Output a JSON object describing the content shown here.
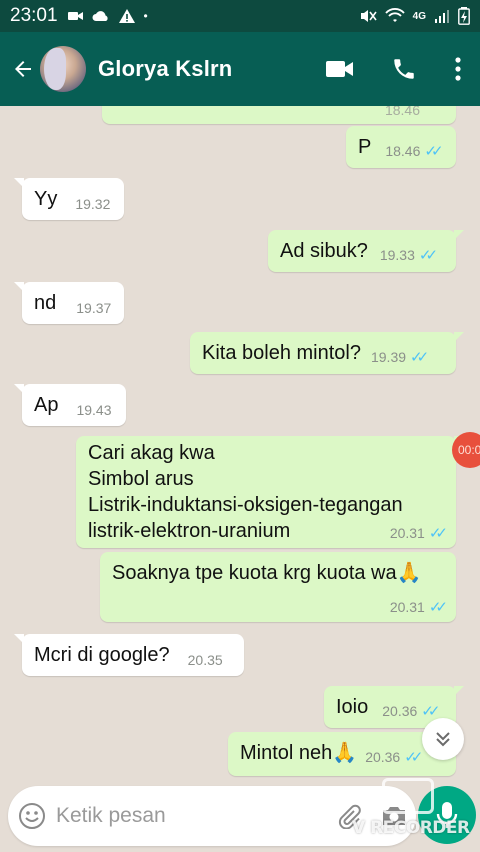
{
  "status_bar": {
    "time": "23:01",
    "network": "4G"
  },
  "header": {
    "contact_name": "Glorya Kslrn"
  },
  "messages": [
    {
      "direction": "out",
      "text": "",
      "time": "18.46",
      "ticks": true
    },
    {
      "direction": "out",
      "text": "P",
      "time": "18.46",
      "ticks": true
    },
    {
      "direction": "in",
      "text": "Yy",
      "time": "19.32"
    },
    {
      "direction": "out",
      "text": "Ad sibuk?",
      "time": "19.33",
      "ticks": true
    },
    {
      "direction": "in",
      "text": "nd",
      "time": "19.37"
    },
    {
      "direction": "out",
      "text": "Kita boleh mintol?",
      "time": "19.39",
      "ticks": true
    },
    {
      "direction": "in",
      "text": "Ap",
      "time": "19.43"
    },
    {
      "direction": "out",
      "text": "Cari akag kwa\nSimbol arus\nListrik-induktansi-oksigen-tegangan\nlistrik-elektron-uranium",
      "time": "20.31",
      "ticks": true
    },
    {
      "direction": "out",
      "text": "Soaknya tpe kuota krg kuota wa🙏",
      "time": "20.31",
      "ticks": true
    },
    {
      "direction": "in",
      "text": "Mcri di google?",
      "time": "20.35"
    },
    {
      "direction": "out",
      "text": "Ioio",
      "time": "20.36",
      "ticks": true
    },
    {
      "direction": "out",
      "text": "Mintol neh🙏",
      "time": "20.36",
      "ticks": true
    }
  ],
  "recorder_badge": "00:0",
  "input": {
    "placeholder": "Ketik pesan"
  },
  "watermark": "V RECORDER",
  "colors": {
    "header": "#075e54",
    "status_bar": "#0d4a3f",
    "out_bubble": "#dcf8c6",
    "in_bubble": "#ffffff",
    "read_ticks": "#4fc3f7",
    "send_button": "#00a884"
  },
  "icons": {
    "back": "arrow-left-icon",
    "video": "video-call-icon",
    "call": "phone-icon",
    "menu": "more-vert-icon",
    "emoji": "emoji-icon",
    "attach": "paperclip-icon",
    "camera": "camera-icon",
    "mic": "mic-icon",
    "scroll": "chevron-double-down-icon"
  }
}
